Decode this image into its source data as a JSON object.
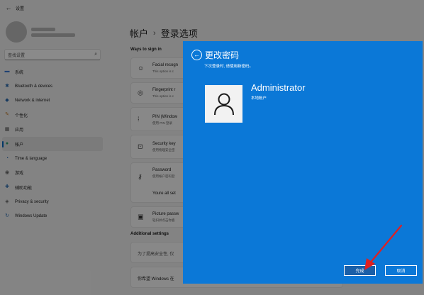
{
  "window": {
    "title": "设置"
  },
  "sidebar": {
    "search_placeholder": "查找设置",
    "items": [
      {
        "label": "系统",
        "icon": "monitor-icon",
        "color": "#3a7bd5"
      },
      {
        "label": "Bluetooth & devices",
        "icon": "bluetooth-icon",
        "color": "#2b6cb0"
      },
      {
        "label": "Network & internet",
        "icon": "wifi-icon",
        "color": "#2b6cb0"
      },
      {
        "label": "个性化",
        "icon": "brush-icon",
        "color": "#c27c2c"
      },
      {
        "label": "应用",
        "icon": "apps-icon",
        "color": "#555555"
      },
      {
        "label": "帐户",
        "icon": "person-icon",
        "color": "#2f9e6a",
        "active": true
      },
      {
        "label": "Time & language",
        "icon": "globe-clock-icon",
        "color": "#2b6cb0"
      },
      {
        "label": "游戏",
        "icon": "gamepad-icon",
        "color": "#666666"
      },
      {
        "label": "辅助功能",
        "icon": "accessibility-icon",
        "color": "#2b6cb0"
      },
      {
        "label": "Privacy & security",
        "icon": "shield-icon",
        "color": "#666666"
      },
      {
        "label": "Windows Update",
        "icon": "update-icon",
        "color": "#2b6cb0"
      }
    ]
  },
  "breadcrumb": {
    "parent": "帐户",
    "separator": "›",
    "current": "登录选项"
  },
  "main": {
    "ways_heading": "Ways to sign in",
    "options": [
      {
        "title": "Facial recogn",
        "sub": "This option is c",
        "icon": "face-icon"
      },
      {
        "title": "Fingerprint r",
        "sub": "This option is c",
        "icon": "fingerprint-icon"
      },
      {
        "title": "PIN (Window",
        "sub": "使用 PIN 登录",
        "icon": "pin-icon"
      },
      {
        "title": "Security key",
        "sub": "使用物理安全密",
        "icon": "key-icon"
      },
      {
        "title": "Password",
        "sub": "使用帐户密码登",
        "icon": "password-icon"
      }
    ],
    "password_status": "Youre all set",
    "picture_password": {
      "title": "Picture passw",
      "sub": "轻扫并点击你喜"
    },
    "additional_heading": "Additional settings",
    "additional_text": "为了提高安全性, 仅",
    "bottom_text": "你希望 Windows 在"
  },
  "dialog": {
    "title": "更改密码",
    "subtitle": "下次登录时, 请使用新密码。",
    "user_name": "Administrator",
    "user_type": "本地帐户",
    "finish_label": "完成",
    "cancel_label": "取消",
    "background_color": "#0b78d7"
  }
}
